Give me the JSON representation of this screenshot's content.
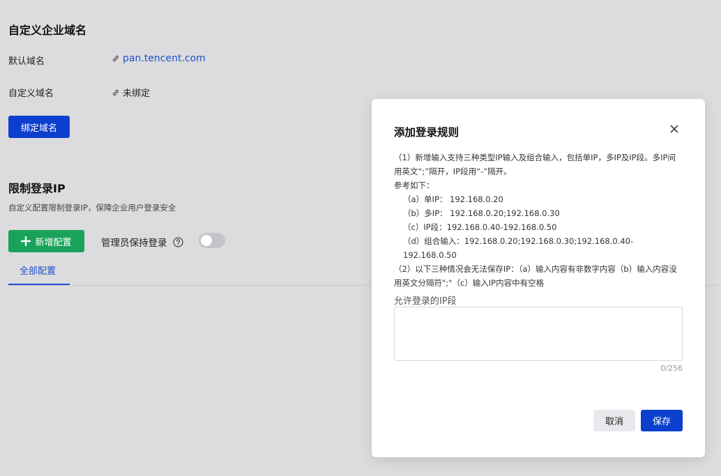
{
  "domain_section": {
    "title": "自定义企业域名",
    "default_label": "默认域名",
    "default_value": "pan.tencent.com",
    "custom_label": "自定义域名",
    "custom_value": "未绑定",
    "bind_button": "绑定域名",
    "link_icon": "link-icon",
    "link_color": "#1d4fcf"
  },
  "ip_section": {
    "title": "限制登录IP",
    "description": "自定义配置限制登录IP，保障企业用户登录安全",
    "add_button": "新增配置",
    "add_icon": "plus-icon",
    "admin_keep_login_label": "管理员保持登录",
    "help_icon": "question-circle-icon",
    "toggle_on": false,
    "tabs": [
      {
        "label": "全部配置",
        "active": true
      }
    ]
  },
  "modal": {
    "title": "添加登录规则",
    "close_icon": "close-icon",
    "rules": [
      "（1）新增输入支持三种类型IP输入及组合输入，包括单IP，多IP及IP段。多IP间用英文“;”隔开，IP段用“-”隔开。",
      "参考如下：",
      "（a）单IP： 192.168.0.20",
      "（b）多IP： 192.168.0.20;192.168.0.30",
      "（c）IP段：192.168.0.40-192.168.0.50",
      "（d）组合输入：192.168.0.20;192.168.0.30;192.168.0.40-192.168.0.50",
      "（2）以下三种情况会无法保存IP：（a）输入内容有非数字内容（b）输入内容没用英文分隔符\";\"（c）输入IP内容中有空格"
    ],
    "field_label": "允许登录的IP段",
    "field_value": "",
    "counter": "0/256",
    "cancel_button": "取消",
    "save_button": "保存"
  },
  "colors": {
    "primary": "#0d3fcf",
    "green": "#1aa25a",
    "background": "#dcdcde"
  }
}
